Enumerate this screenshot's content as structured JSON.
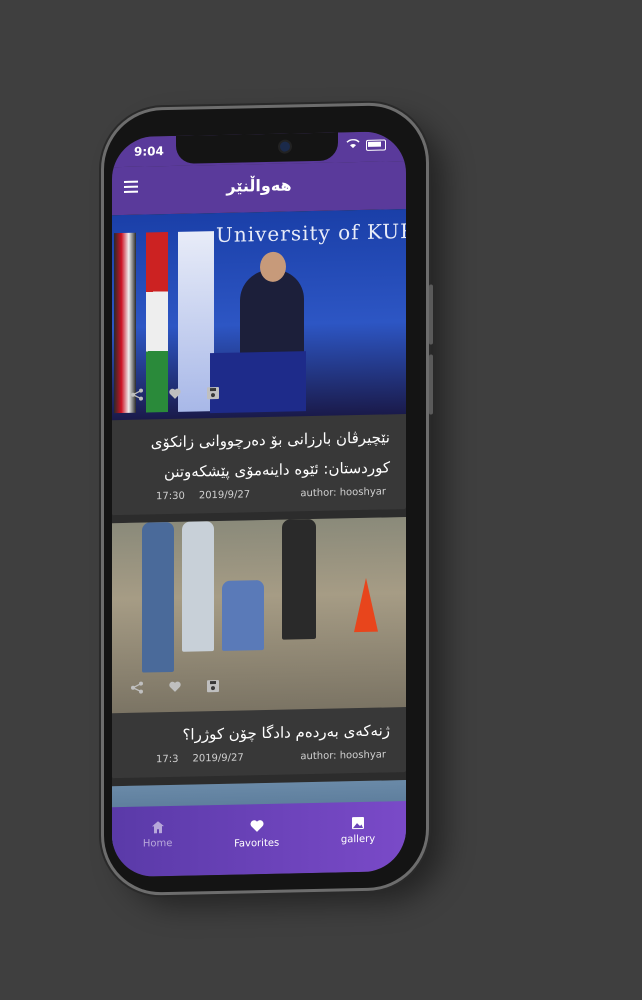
{
  "status": {
    "time": "9:04"
  },
  "appbar": {
    "title": "هەواڵنێر"
  },
  "icons": {
    "share": "share-icon",
    "favorite": "heart-icon",
    "save": "save-icon",
    "menu": "menu-icon"
  },
  "articles": [
    {
      "headline": "نێچیرڤان بارزانی بۆ دەرچووانی زانکۆی کوردستان: ئێوە داینەمۆی پێشکەوتنن",
      "time": "17:30",
      "date": "2019/9/27",
      "author": "author: hooshyar",
      "image_text": "University of KURDISTAN"
    },
    {
      "headline": "ژنەکەی بەردەم دادگا چۆن کوژرا؟",
      "time": "17:3",
      "date": "2019/9/27",
      "author": "author: hooshyar"
    }
  ],
  "tabbar": {
    "home": "Home",
    "favorites": "Favorites",
    "gallery": "gallery"
  },
  "colors": {
    "primary": "#5a3a9b",
    "background": "#3f3f3f",
    "card": "#383838"
  }
}
